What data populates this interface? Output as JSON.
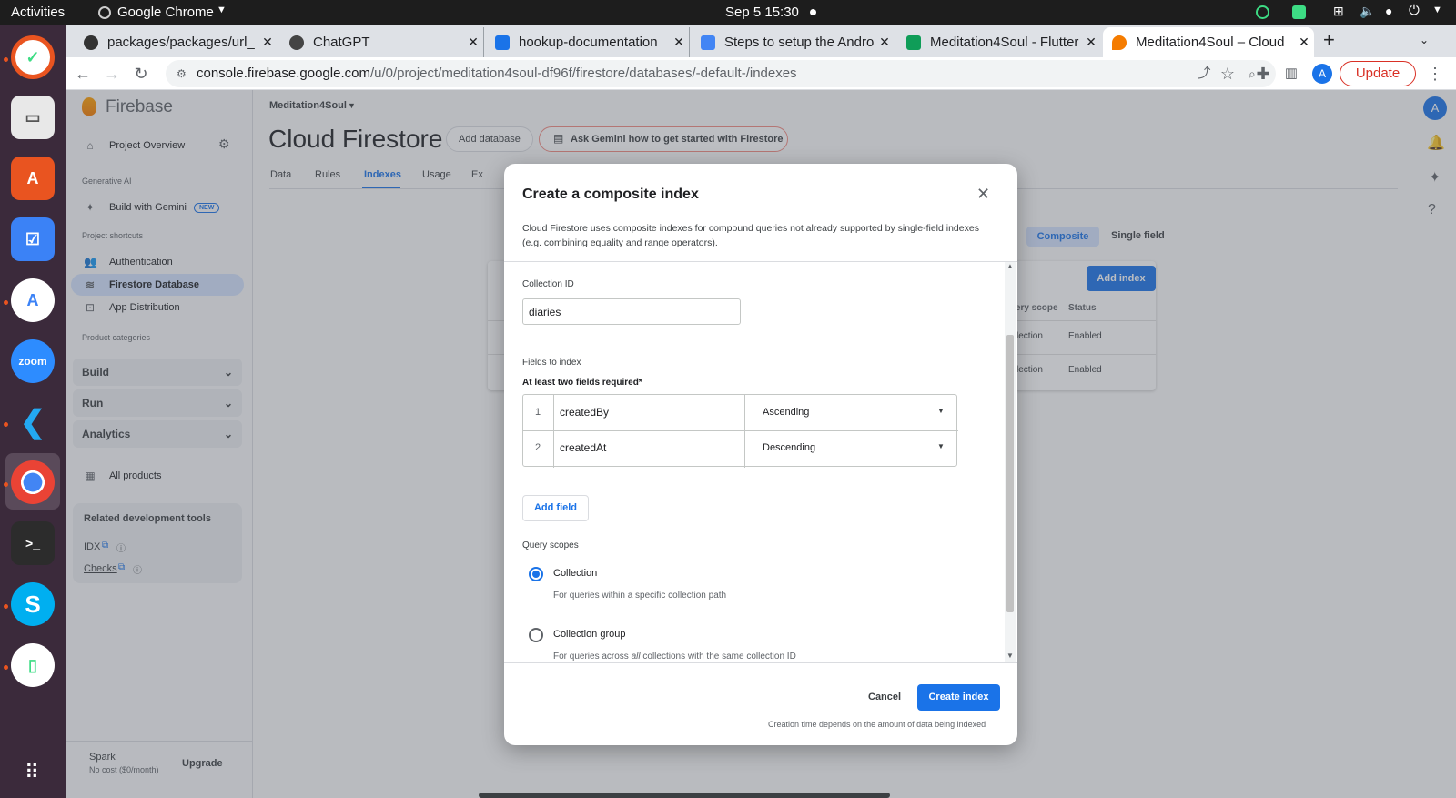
{
  "os": {
    "activities": "Activities",
    "app_name": "Google Chrome",
    "clock": "Sep 5  15:30",
    "dock_apps": [
      "Ubuntu Software Updater",
      "Files",
      "App Center",
      "Tasks",
      "Android Studio",
      "zoom",
      "Visual Studio Code",
      "Google Chrome",
      "Terminal",
      "Skype",
      "Device"
    ],
    "zoom_label": "zoom"
  },
  "browser": {
    "tabs": [
      {
        "title": "packages/packages/url_",
        "color": "#333333"
      },
      {
        "title": "ChatGPT",
        "color": "#444444"
      },
      {
        "title": "hookup-documentation",
        "color": "#1a73e8"
      },
      {
        "title": "Steps to setup the Andro",
        "color": "#4285f4"
      },
      {
        "title": "Meditation4Soul - Flutter",
        "color": "#0f9d58"
      },
      {
        "title": "Meditation4Soul – Cloud",
        "color": "#f57c00"
      }
    ],
    "url_domain": "console.firebase.google.com",
    "url_path": "/u/0/project/meditation4soul-df96f/firestore/databases/-default-/indexes",
    "update_label": "Update",
    "profile_initial": "A"
  },
  "firebase": {
    "brand": "Firebase",
    "project_overview": "Project Overview",
    "generative_ai_label": "Generative AI",
    "build_with_gemini": "Build with Gemini",
    "new_badge": "NEW",
    "project_shortcuts_label": "Project shortcuts",
    "shortcuts": [
      "Authentication",
      "Firestore Database",
      "App Distribution"
    ],
    "product_categories_label": "Product categories",
    "groups": [
      "Build",
      "Run",
      "Analytics"
    ],
    "all_products": "All products",
    "related_tools_title": "Related development tools",
    "tools": [
      "IDX",
      "Checks"
    ],
    "plan_name": "Spark",
    "plan_desc": "No cost ($0/month)",
    "upgrade": "Upgrade",
    "project_name": "Meditation4Soul",
    "page_title": "Cloud Firestore",
    "add_database": "Add database",
    "ask_gemini": "Ask Gemini how to get started with Firestore",
    "tabs": [
      "Data",
      "Rules",
      "Indexes",
      "Usage",
      "Ex"
    ],
    "active_tab": "Indexes",
    "index_toggle": [
      "Composite",
      "Single field"
    ],
    "add_index": "Add index",
    "table_headers": [
      "Query scope",
      "Status"
    ],
    "table_rows": [
      {
        "scope": "Collection",
        "status": "Enabled"
      },
      {
        "scope": "Collection",
        "status": "Enabled"
      }
    ],
    "user_initial": "A"
  },
  "dialog": {
    "title": "Create a composite index",
    "description": "Cloud Firestore uses composite indexes for compound queries not already supported by single-field indexes (e.g. combining equality and range operators).",
    "collection_id_label": "Collection ID",
    "collection_id_value": "diaries",
    "fields_label": "Fields to index",
    "fields_hint": "At least two fields required*",
    "fields": [
      {
        "num": "1",
        "name": "createdBy",
        "order": "Ascending"
      },
      {
        "num": "2",
        "name": "createdAt",
        "order": "Descending"
      }
    ],
    "add_field": "Add field",
    "query_scopes_label": "Query scopes",
    "scopes": [
      {
        "title": "Collection",
        "desc": "For queries within a specific collection path",
        "selected": true
      },
      {
        "title": "Collection group",
        "desc_pre": "For queries across ",
        "desc_em": "all",
        "desc_post": " collections with the same collection ID",
        "selected": false
      }
    ],
    "cancel": "Cancel",
    "create": "Create index",
    "footer_note": "Creation time depends on the amount of data being indexed"
  },
  "colors": {
    "accent": "#1a73e8",
    "firebase_orange": "#ff9100"
  }
}
